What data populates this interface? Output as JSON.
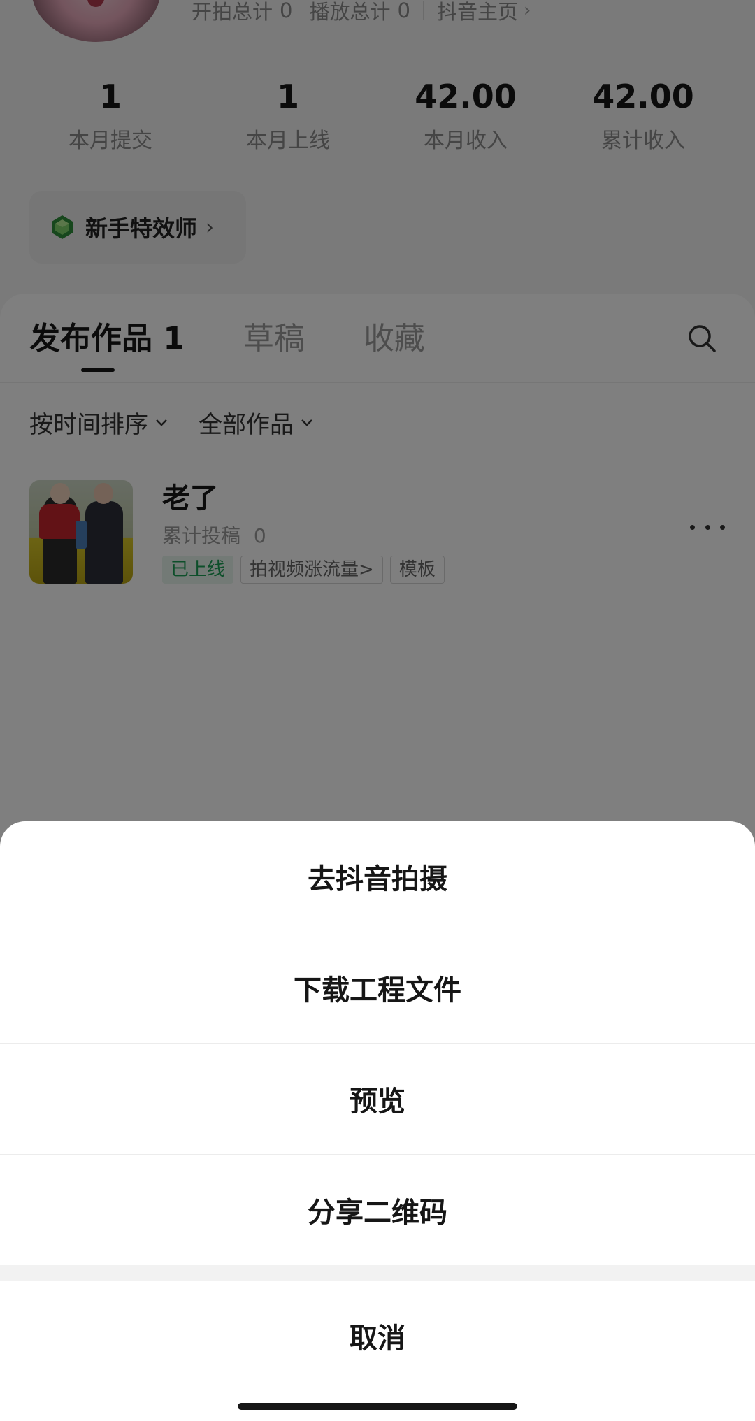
{
  "profile": {
    "top_stats": {
      "shoot_total_label": "开拍总计",
      "shoot_total_value": "0",
      "play_total_label": "播放总计",
      "play_total_value": "0",
      "douyin_home_link": "抖音主页",
      "chevron": "›"
    },
    "stats": [
      {
        "value": "1",
        "label": "本月提交"
      },
      {
        "value": "1",
        "label": "本月上线"
      },
      {
        "value": "42.00",
        "label": "本月收入"
      },
      {
        "value": "42.00",
        "label": "累计收入"
      }
    ],
    "badge": {
      "label": "新手特效师",
      "icon": "gem-icon",
      "chevron": "›"
    }
  },
  "tabs": [
    {
      "label": "发布作品 1",
      "active": true
    },
    {
      "label": "草稿",
      "active": false
    },
    {
      "label": "收藏",
      "active": false
    }
  ],
  "filters": {
    "sort": "按时间排序",
    "category": "全部作品"
  },
  "works": [
    {
      "title": "老了",
      "submissions_label": "累计投稿",
      "submissions_value": "0",
      "tags": {
        "status": "已上线",
        "promo": "拍视频涨流量>",
        "type": "模板"
      }
    }
  ],
  "action_sheet": {
    "items": [
      "去抖音拍摄",
      "下载工程文件",
      "预览",
      "分享二维码"
    ],
    "cancel": "取消"
  },
  "colors": {
    "accent_green": "#1b9e55",
    "overlay": "rgba(0,0,0,0.5)",
    "text_primary": "#161616",
    "text_secondary": "#8a8a8a"
  }
}
